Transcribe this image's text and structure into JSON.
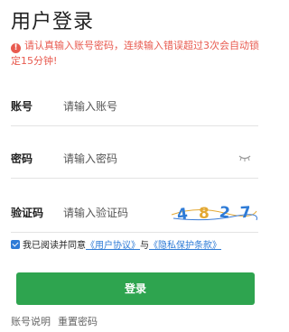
{
  "page": {
    "title": "用户登录"
  },
  "warning": {
    "text": "请认真输入账号密码，连续输入错误超过3次会自动锁定15分钟!",
    "icon": "exclamation-icon"
  },
  "form": {
    "username": {
      "label": "账号",
      "placeholder": "请输入账号"
    },
    "password": {
      "label": "密码",
      "placeholder": "请输入密码",
      "icon": "eye-closed-icon"
    },
    "captcha": {
      "label": "验证码",
      "placeholder": "请输入验证码",
      "code": "4827"
    }
  },
  "agreement": {
    "prefix": "我已阅读并同意",
    "link1": "《用户协议》",
    "joiner": "与",
    "link2": "《隐私保护条款》"
  },
  "login_button": {
    "label": "登录"
  },
  "footer": {
    "account_help": "账号说明",
    "reset_password": "重置密码"
  },
  "colors": {
    "primary": "#2ea44f",
    "warning": "#e85a4f",
    "link": "#2e7bd6"
  }
}
